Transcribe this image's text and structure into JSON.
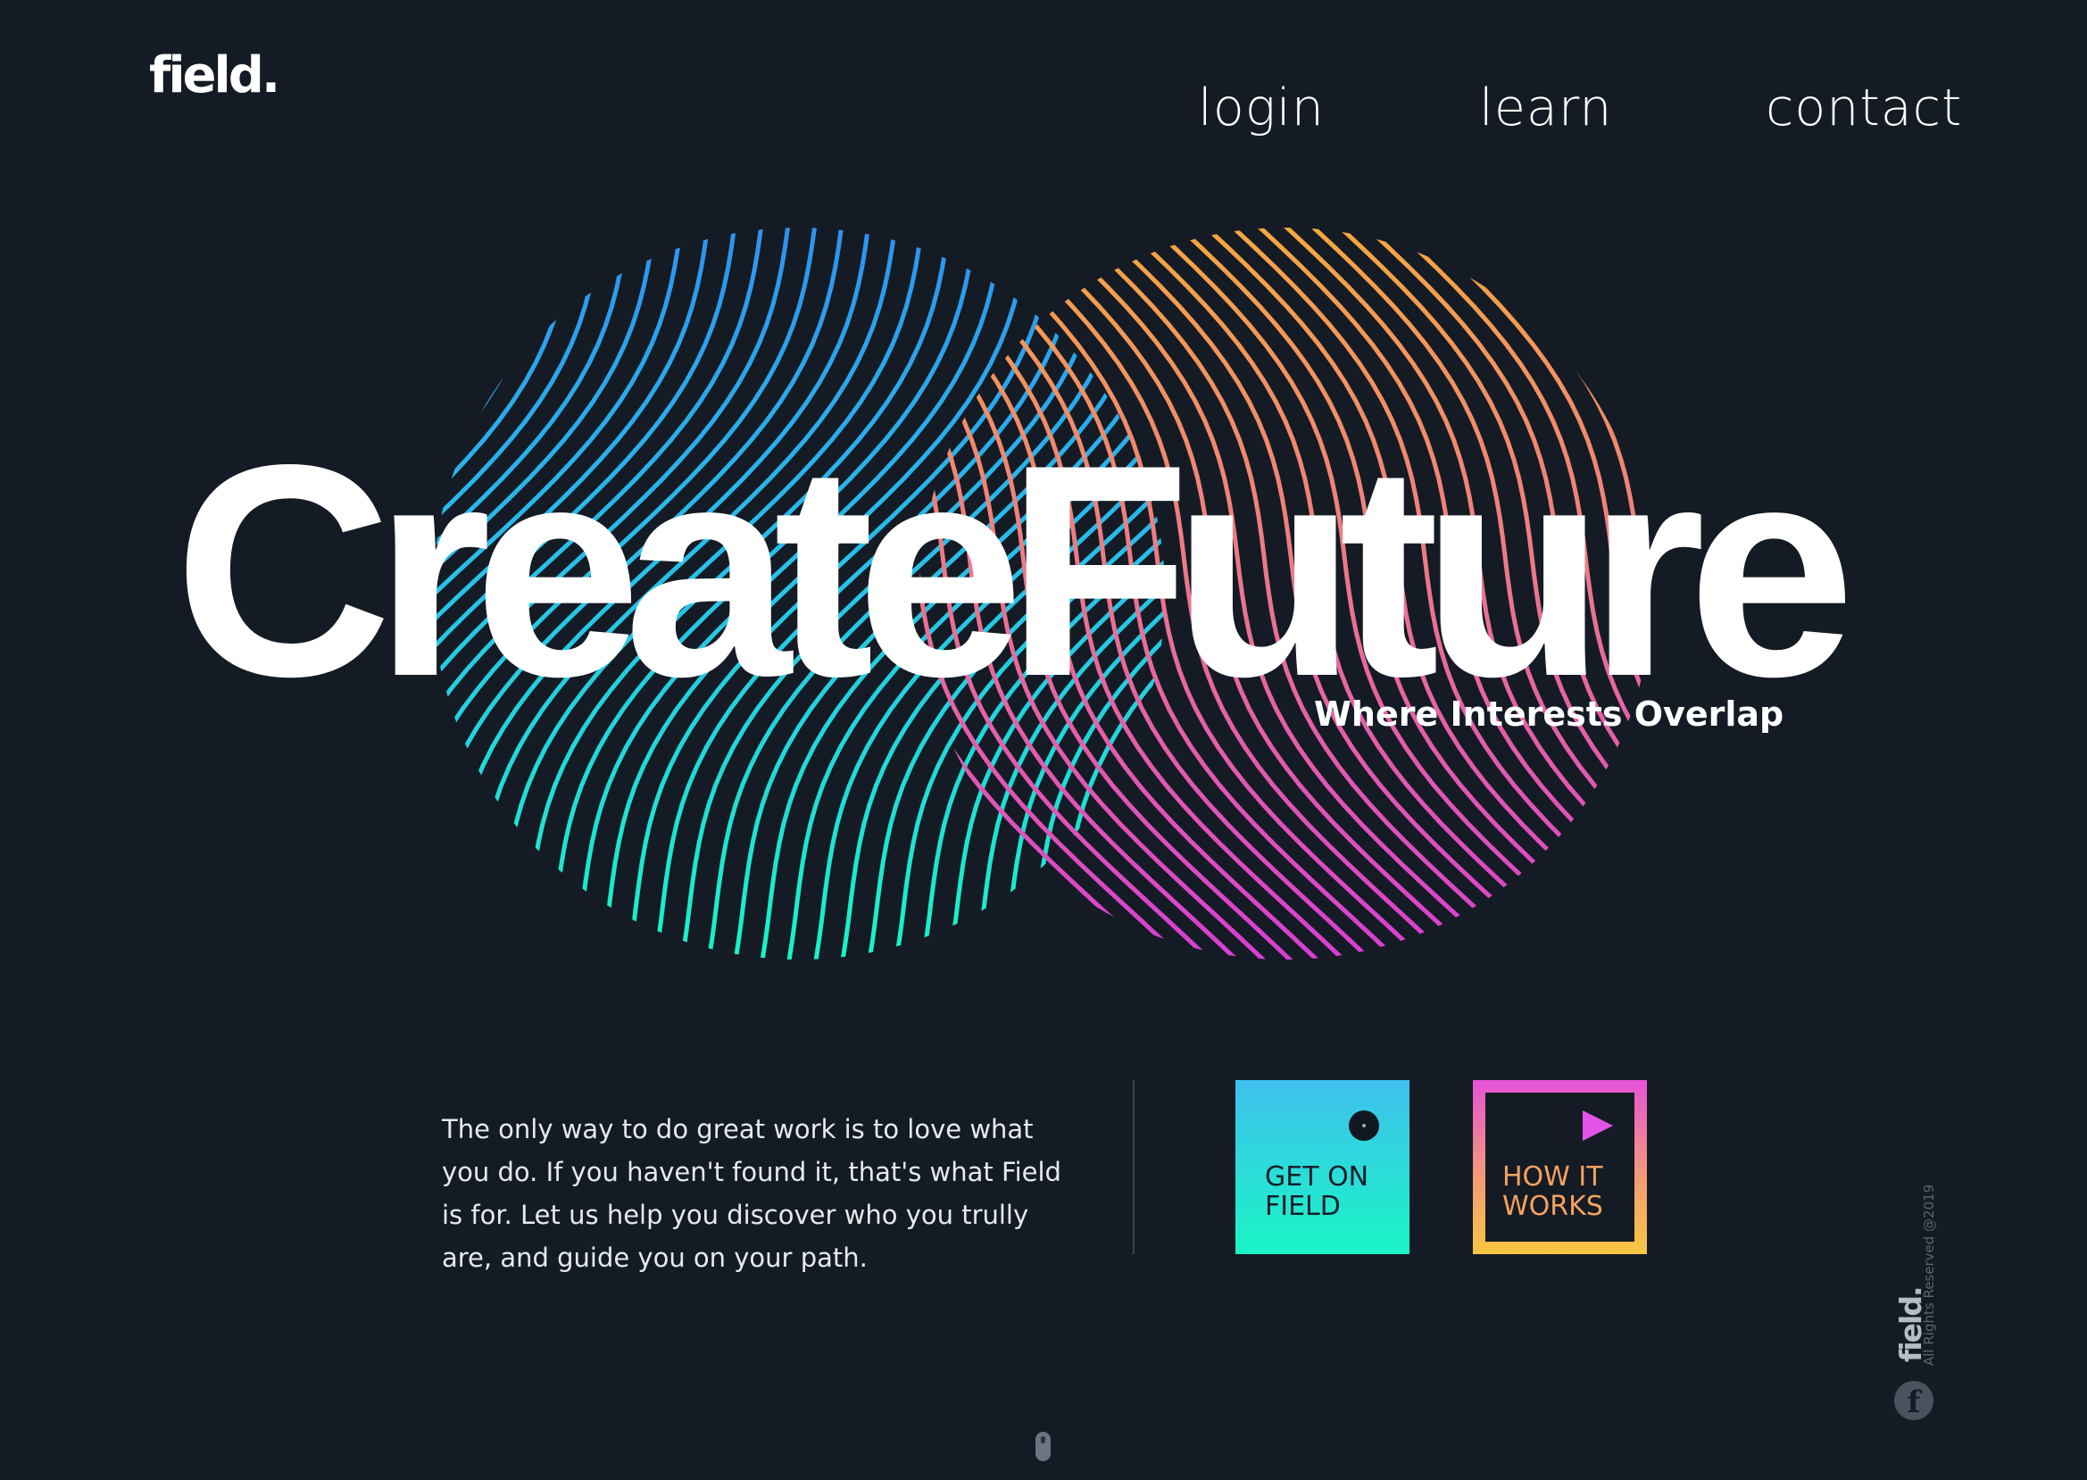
{
  "brand": {
    "logo_text": "field."
  },
  "nav": {
    "login": "login",
    "learn": "learn",
    "contact": "contact"
  },
  "hero": {
    "headline": "CreateFuture",
    "tagline": "Where Interests Overlap"
  },
  "intro": {
    "text": "The only way to do great work is to love what you do. If you haven't found it, that's what Field is for. Let us help you discover who you trully are, and guide you on your path."
  },
  "actions": {
    "get_on_field": "GET ON\nFIELD",
    "how_it_works": "HOW IT\nWORKS"
  },
  "footer": {
    "copyright": "All Rights Reserved @2019",
    "mini_logo": "field.",
    "social_icon": "f"
  },
  "icons": {
    "play": "play-icon",
    "dot": "dot-icon",
    "facebook": "facebook-icon",
    "scroll": "mouse-scroll-icon"
  },
  "colors": {
    "background": "#141b24",
    "blue_start": "#2f8ff0",
    "teal_end": "#19f5c5",
    "orange_start": "#f7a93a",
    "magenta_end": "#d63ad8"
  }
}
